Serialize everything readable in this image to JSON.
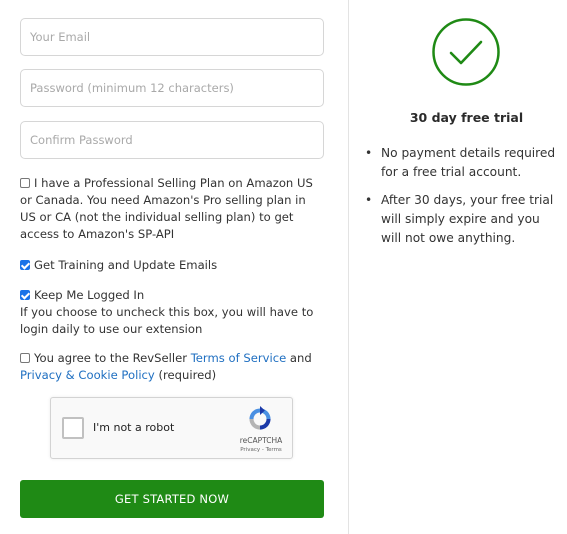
{
  "form": {
    "email_placeholder": "Your Email",
    "password_placeholder": "Password (minimum 12 characters)",
    "confirm_placeholder": "Confirm Password"
  },
  "options": {
    "professional_plan": {
      "checked": false,
      "text": "I have a Professional Selling Plan on Amazon US or Canada. You need Amazon's Pro selling plan in US or CA (not the individual selling plan) to get access to Amazon's SP-API"
    },
    "training_emails": {
      "checked": true,
      "text": "Get Training and Update Emails"
    },
    "keep_logged_in": {
      "checked": true,
      "text": "Keep Me Logged In",
      "note": "If you choose to uncheck this box, you will have to login daily to use our extension"
    },
    "agree_terms": {
      "checked": false,
      "prefix": "You agree to the RevSeller ",
      "terms_link": "Terms of Service",
      "middle": " and",
      "privacy_link": "Privacy & Cookie Policy",
      "suffix": " (required)"
    }
  },
  "captcha": {
    "label": "I'm not a robot",
    "brand": "reCAPTCHA",
    "links": "Privacy - Terms"
  },
  "cta": {
    "label": "GET STARTED NOW",
    "color": "#1f8a15"
  },
  "trial": {
    "badge_color": "#1f8a15",
    "title": "30 day free trial",
    "benefits": [
      "No payment details required for a free trial account.",
      "After 30 days, your free trial will simply expire and you will not owe anything."
    ]
  }
}
